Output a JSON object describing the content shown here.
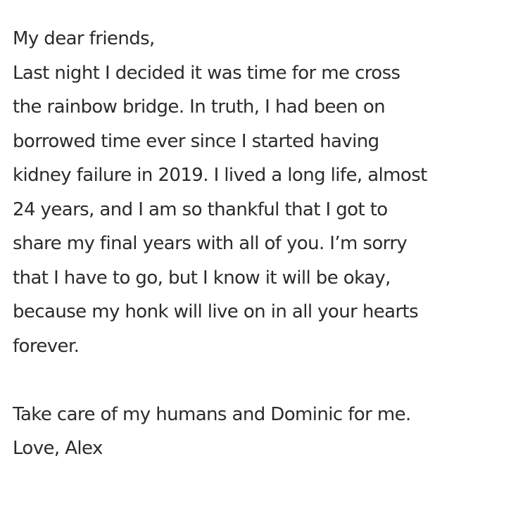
{
  "note": {
    "greeting": "My dear friends,",
    "body_lines": [
      "Last night I decided it was time for me cross",
      "the rainbow bridge. In truth, I had been on",
      "borrowed time ever since I started having",
      "kidney failure in 2019. I lived a long life, almost",
      "24 years, and I am so thankful that I got to",
      "share my final years with all of you. I’m sorry",
      "that I have to go, but I know it will be okay,",
      "because my honk will live on in all your hearts",
      "forever."
    ],
    "closing_line": "Take care of my humans and Dominic for me.",
    "signoff": "Love, Alex"
  }
}
